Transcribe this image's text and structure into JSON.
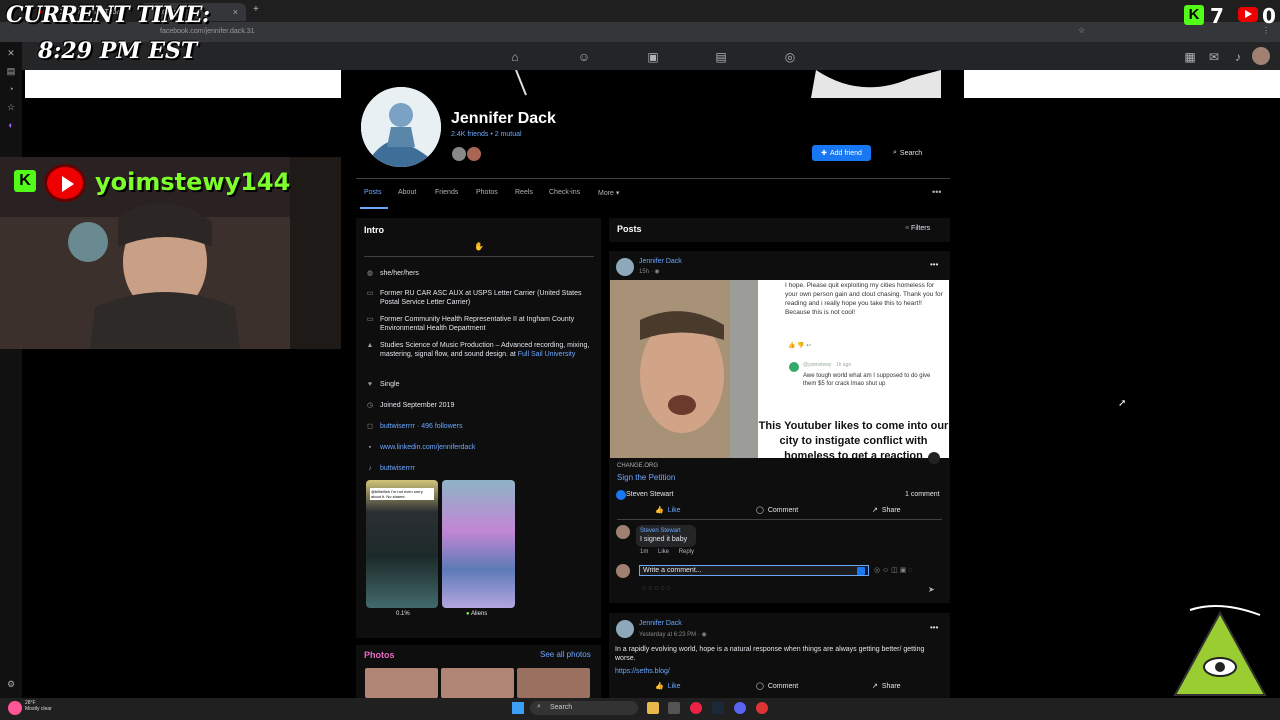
{
  "overlay": {
    "time_label": "CURRENT TIME:",
    "time_value": "8:29 PM EST",
    "streamer": "yoimstewy144",
    "kick_count": "7",
    "yt_count": "0"
  },
  "browser": {
    "tabs": [
      {
        "label": "(1) Cauliflied - YouTube"
      },
      {
        "label": "Facebook"
      }
    ],
    "url": "facebook.com/jennifer.dack.31"
  },
  "profile": {
    "name": "Jennifer Dack",
    "friends": "2.4K friends",
    "mutual": "2 mutual",
    "add_friend_label": "Add friend",
    "search_label": "Search",
    "tabs": [
      {
        "label": "Posts"
      },
      {
        "label": "About"
      },
      {
        "label": "Friends"
      },
      {
        "label": "Photos"
      },
      {
        "label": "Reels"
      },
      {
        "label": "Check-ins"
      },
      {
        "label": "More"
      }
    ]
  },
  "intro": {
    "title": "Intro",
    "rows": [
      {
        "icon": "pronoun-icon",
        "text": "she/her/hers"
      },
      {
        "icon": "briefcase-icon",
        "text": "Former RU CAR ASC AUX at USPS Letter Carrier (United States Postal Service Letter Carrier)"
      },
      {
        "icon": "briefcase-icon",
        "text": "Former Community Health Representative II at Ingham County Environmental Health Department"
      },
      {
        "icon": "school-icon",
        "text": "Studies Science of Music Production – Advanced recording, mixing, mastering, signal flow, and sound design. at",
        "link": "Full Sail University"
      },
      {
        "icon": "heart-icon",
        "text": "Single"
      },
      {
        "icon": "clock-icon",
        "text": "Joined September 2019"
      },
      {
        "icon": "instagram-icon",
        "link": "buttwiserrrr · 496 followers"
      },
      {
        "icon": "linkedin-icon",
        "link": "www.linkedin.com/jenniferdack"
      },
      {
        "icon": "tiktok-icon",
        "link": "buttwiserrrr"
      }
    ],
    "featured": [
      {
        "caption": "@billieilish I'm not even sorry about it. No shame.",
        "label": "0.1%"
      },
      {
        "caption": "",
        "label": "Aliens"
      }
    ]
  },
  "photos": {
    "title": "Photos",
    "see_all": "See all photos"
  },
  "posts": {
    "title": "Posts",
    "filters_label": "Filters",
    "post1": {
      "author": "Jennifer Dack",
      "time": "15h",
      "shared_comment": "I hope. Please quit exploiting my cities homeless for your own person gain and clout chasing. Thank you for reading and i really hope you take this to heart!! Because this is not cool!",
      "reply_user": "@yoimstewy · 1h ago",
      "reply_text": "Awe tough world what am I supposed to do give them $5 for crack lmao shut up",
      "headline": "This Youtuber likes to come into our city to instigate conflict with homeless to get a reaction",
      "source": "CHANGE.ORG",
      "cta": "Sign the Petition",
      "reactor": "Steven Stewart",
      "comment_count": "1 comment",
      "like_label": "Like",
      "comment_label": "Comment",
      "share_label": "Share",
      "comment": {
        "name": "Steven Stewart",
        "text": "I signed it baby",
        "age": "1m",
        "like": "Like",
        "reply": "Reply"
      },
      "write_placeholder": "Write a comment..."
    },
    "post2": {
      "author": "Jennifer Dack",
      "time": "Yesterday at 6:23 PM",
      "text": "In a rapidly evolving world, hope is a natural response when things are always getting better/ getting worse.",
      "link": "https://seths.blog/",
      "like_label": "Like",
      "comment_label": "Comment",
      "share_label": "Share"
    }
  },
  "taskbar": {
    "temp": "28°F",
    "condition": "Mostly clear",
    "search": "Search"
  },
  "colors": {
    "accent": "#1877f2",
    "link": "#6aa7ff",
    "card": "#0e0e0f",
    "streamer_green": "#7cff2a"
  }
}
